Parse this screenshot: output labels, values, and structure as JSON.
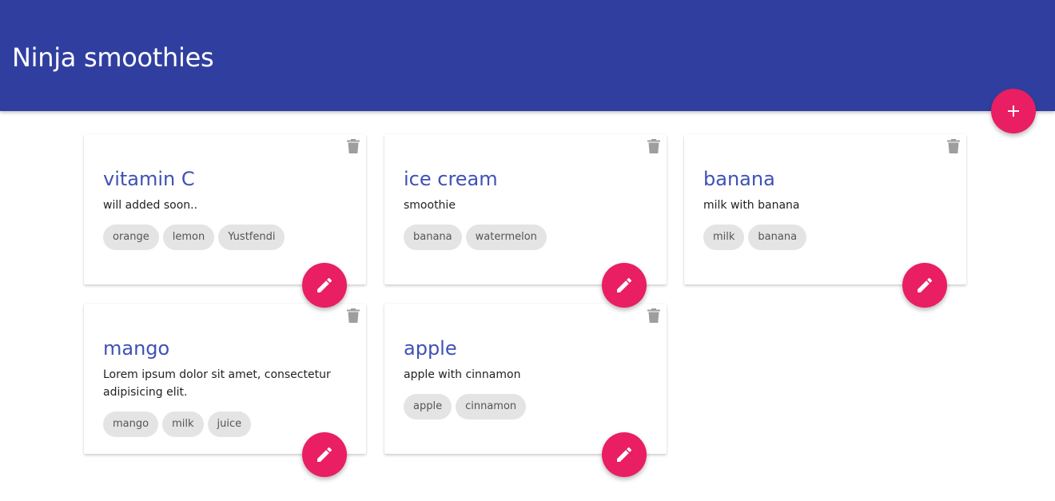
{
  "app": {
    "title": "Ninja smoothies"
  },
  "colors": {
    "navbar": "#303f9f",
    "accent": "#e91e63",
    "title": "#3f51b5",
    "chip": "#e4e4e4"
  },
  "icons": {
    "add": "plus-icon",
    "delete": "trash-icon",
    "edit": "pencil-icon"
  },
  "smoothies": [
    {
      "title": "vitamin C",
      "description": "will added soon..",
      "ingredients": [
        "orange",
        "lemon",
        "Yustfendi"
      ]
    },
    {
      "title": "ice cream",
      "description": "smoothie",
      "ingredients": [
        "banana",
        "watermelon"
      ]
    },
    {
      "title": "banana",
      "description": "milk with banana",
      "ingredients": [
        "milk",
        "banana"
      ]
    },
    {
      "title": "mango",
      "description": "Lorem ipsum dolor sit amet, consectetur adipisicing elit.",
      "ingredients": [
        "mango",
        "milk",
        "juice"
      ]
    },
    {
      "title": "apple",
      "description": "apple with cinnamon",
      "ingredients": [
        "apple",
        "cinnamon"
      ]
    }
  ]
}
